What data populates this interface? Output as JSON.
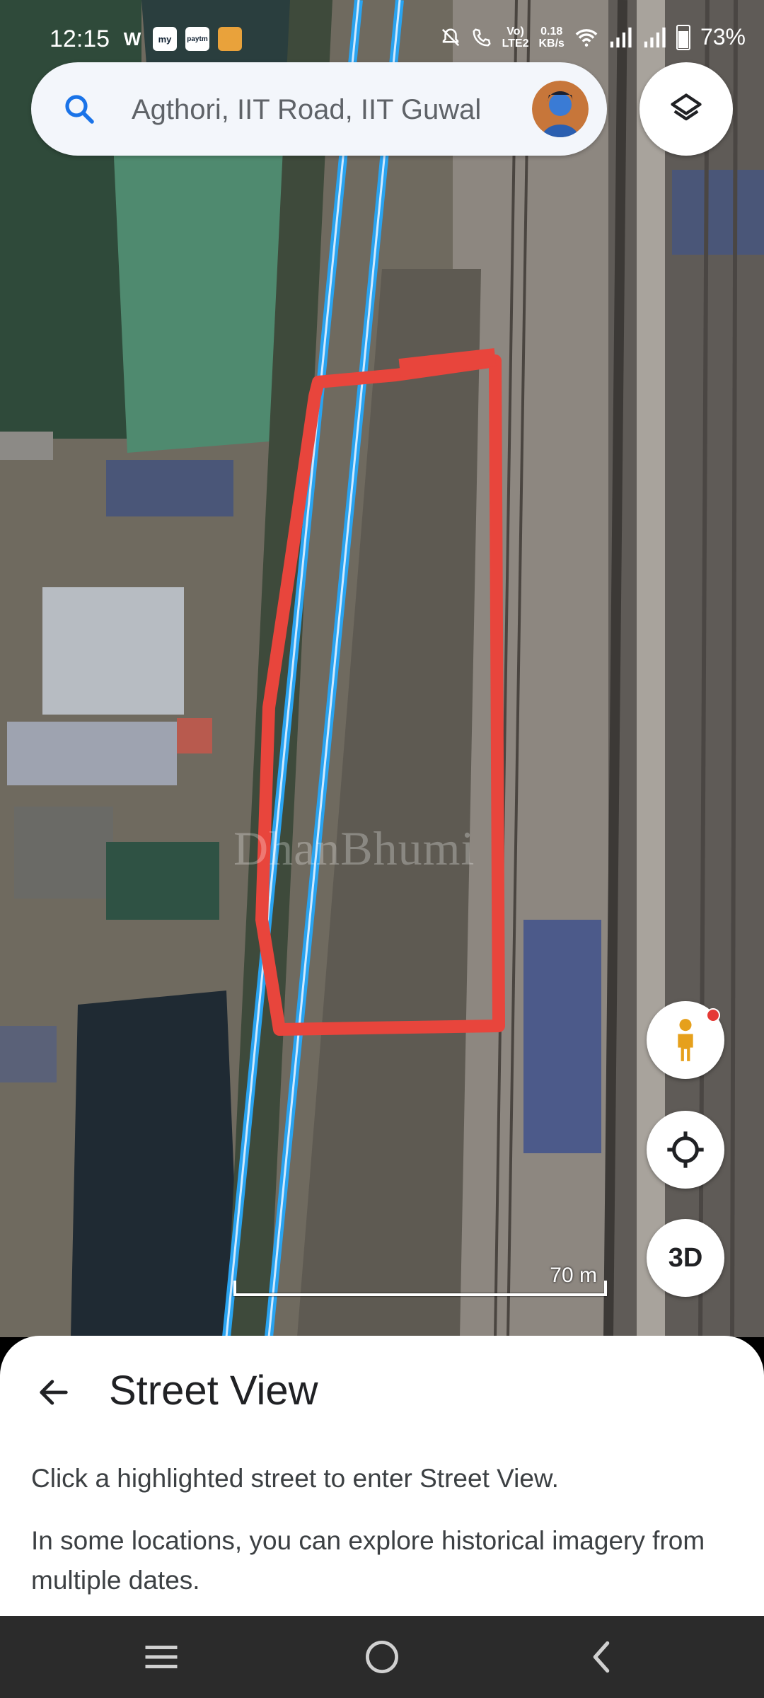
{
  "status_bar": {
    "time": "12:15",
    "app_icons": [
      "W",
      "my",
      "paytm",
      "box"
    ],
    "network_speed": "0.18\nKB/s",
    "network_type": "Vo)\nLTE2",
    "battery_percent": "73%"
  },
  "search": {
    "value": "Agthori, IIT Road, IIT Guwal",
    "placeholder": "Search here"
  },
  "map": {
    "scale_label": "70 m",
    "watermark": "DhanBhumi",
    "highlight_color": "#e8453c",
    "route_color": "#29a3f0"
  },
  "controls": {
    "layers_icon": "layers-icon",
    "pegman_icon": "pegman-icon",
    "locate_icon": "my-location-icon",
    "three_d_label": "3D"
  },
  "sheet": {
    "title": "Street View",
    "line1": "Click a highlighted street to enter Street View.",
    "line2": "In some locations, you can explore historical imagery from multiple dates."
  },
  "navbar": {
    "items": [
      "recent-apps-icon",
      "home-icon",
      "back-icon"
    ]
  }
}
